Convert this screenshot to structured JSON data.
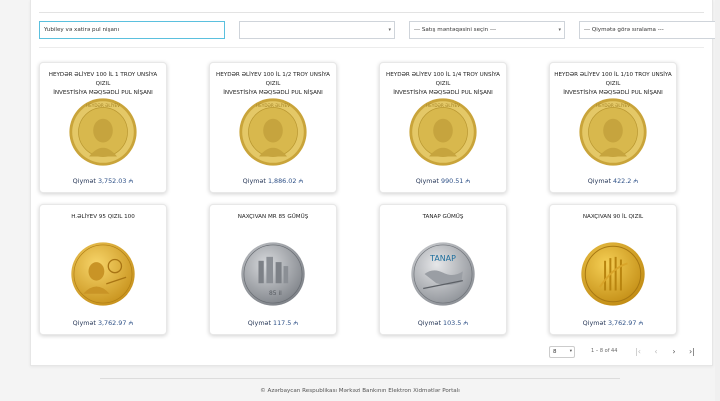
{
  "filters": {
    "search_value": "Yubiley və xatirə pul nişanı",
    "category_value": "",
    "sales_point_value": "--- Satış məntəqəsini seçin ---",
    "sort_value": "--- Qiymətə görə sıralama ---"
  },
  "price_label": "Qiymət",
  "currency_symbol": "₼",
  "cards": [
    {
      "title_line1": "HEYDƏR ƏLİYEV 100 İL 1 TROY UNSİYA QIZIL",
      "title_line2": "İNVESTİSİYA MƏQSƏDLİ PUL NİŞANI",
      "price": "3,752.03",
      "coin": "gold-portrait"
    },
    {
      "title_line1": "HEYDƏR ƏLİYEV 100 İL 1/2 TROY UNSİYA QIZIL",
      "title_line2": "İNVESTİSİYA MƏQSƏDLİ PUL NİŞANI",
      "price": "1,886.02",
      "coin": "gold-portrait"
    },
    {
      "title_line1": "HEYDƏR ƏLİYEV 100 İL 1/4 TROY UNSİYA QIZIL",
      "title_line2": "İNVESTİSİYA MƏQSƏDLİ PUL NİŞANI",
      "price": "990.51",
      "coin": "gold-portrait"
    },
    {
      "title_line1": "HEYDƏR ƏLİYEV 100 İL 1/10 TROY UNSİYA QIZIL",
      "title_line2": "İNVESTİSİYA MƏQSƏDLİ PUL NİŞANI",
      "price": "422.2",
      "coin": "gold-portrait"
    },
    {
      "title_line1": "H.ƏLİYEV 95 QIZIL 100",
      "title_line2": "",
      "price": "3,762.97",
      "coin": "gold-scene"
    },
    {
      "title_line1": "NAXÇIVAN MR 85 GÜMÜŞ",
      "title_line2": "",
      "price": "117.5",
      "coin": "silver-city"
    },
    {
      "title_line1": "TANAP GÜMÜŞ",
      "title_line2": "",
      "price": "103.5",
      "coin": "silver-tanap"
    },
    {
      "title_line1": "NAXÇIVAN 90 İL QIZIL",
      "title_line2": "",
      "price": "3,762.97",
      "coin": "gold-90"
    }
  ],
  "pagination": {
    "per_page": "8",
    "range_text": "1 – 8 of 44",
    "first_icon": "first-page-icon",
    "prev_icon": "prev-page-icon",
    "next_icon": "next-page-icon",
    "last_icon": "last-page-icon"
  },
  "coin_texts": {
    "portrait_ring_text": "HEYDƏR ƏLİYEV",
    "tanap_text": "TANAP",
    "silver_denom": "85 il"
  },
  "footer_text": "© Azərbaycan Respublikası Mərkəzi Bankının Elektron Xidmətlər Portalı",
  "colors": {
    "accent": "#5bc0de",
    "price": "#2c4f86",
    "gold": "#d9b84a",
    "silver": "#b9bcc1"
  }
}
